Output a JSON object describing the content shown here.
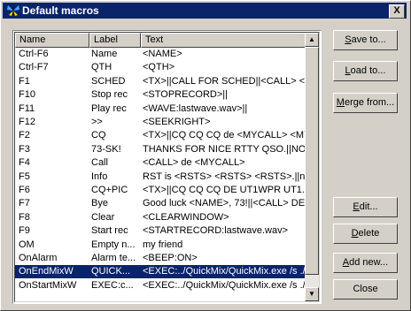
{
  "window": {
    "title": "Default macros",
    "close_glyph": "X",
    "icon": "butterfly-icon"
  },
  "columns": [
    "Name",
    "Label",
    "Text"
  ],
  "rows": [
    {
      "name": "Ctrl-F6",
      "label": "Name",
      "text": "<NAME>"
    },
    {
      "name": "Ctrl-F7",
      "label": "QTH",
      "text": "<QTH>"
    },
    {
      "name": "F1",
      "label": "SCHED",
      "text": "<TX>||CALL FOR SCHED||<CALL> <C"
    },
    {
      "name": "F10",
      "label": "Stop rec",
      "text": "<STOPRECORD>||"
    },
    {
      "name": "F11",
      "label": "Play rec",
      "text": "<WAVE:lastwave.wav>||"
    },
    {
      "name": "F12",
      "label": ">>",
      "text": "<SEEKRIGHT>"
    },
    {
      "name": "F2",
      "label": "CQ",
      "text": "<TX>||CQ CQ CQ de <MYCALL> <MY"
    },
    {
      "name": "F3",
      "label": "73-SK!",
      "text": "THANKS FOR NICE RTTY QSO.||NO."
    },
    {
      "name": "F4",
      "label": "Call",
      "text": "<CALL> de <MYCALL>"
    },
    {
      "name": "F5",
      "label": "Info",
      "text": "RST is <RSTS> <RSTS> <RSTS>.||na"
    },
    {
      "name": "F6",
      "label": "CQ+PIC",
      "text": "<TX>||CQ CQ CQ DE UT1WPR UT1..."
    },
    {
      "name": "F7",
      "label": "Bye",
      "text": "Good luck <NAME>, 73!||<CALL> DE ."
    },
    {
      "name": "F8",
      "label": "Clear",
      "text": "<CLEARWINDOW>"
    },
    {
      "name": "F9",
      "label": "Start rec",
      "text": "<STARTRECORD:lastwave.wav>"
    },
    {
      "name": "OM",
      "label": "Empty n...",
      "text": "my friend"
    },
    {
      "name": "OnAlarm",
      "label": "Alarm te...",
      "text": "<BEEP:ON>"
    },
    {
      "name": "OnEndMixW",
      "label": "QUICK...",
      "text": "<EXEC:../QuickMix/QuickMix.exe /s ./",
      "selected": true
    },
    {
      "name": "OnStartMixW",
      "label": "EXEC:c...",
      "text": "<EXEC:../QuickMix/QuickMix.exe /s ./"
    }
  ],
  "buttons": {
    "save": {
      "pre": "",
      "key": "S",
      "post": "ave to..."
    },
    "load": {
      "pre": "",
      "key": "L",
      "post": "oad to..."
    },
    "merge": {
      "pre": "",
      "key": "M",
      "post": "erge from..."
    },
    "edit": {
      "pre": "",
      "key": "E",
      "post": "dit..."
    },
    "delete": {
      "pre": "",
      "key": "D",
      "post": "elete"
    },
    "add": {
      "pre": "",
      "key": "A",
      "post": "dd new..."
    },
    "close": {
      "label": "Close"
    }
  },
  "colors": {
    "title_bg": "#0a246a",
    "selection_bg": "#0a246a",
    "face": "#d4d0c8"
  }
}
